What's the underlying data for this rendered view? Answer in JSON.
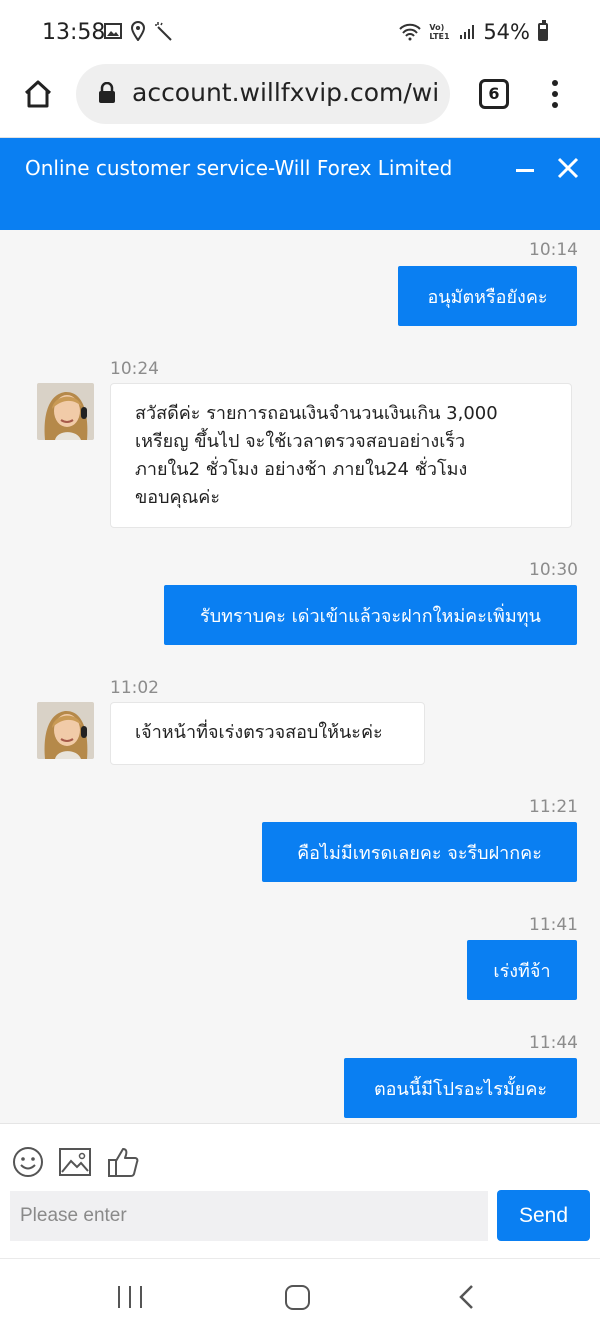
{
  "status_bar": {
    "time": "13:58",
    "battery": "54%",
    "network": "Vo) LTE1"
  },
  "browser": {
    "url": "account.willfxvip.com/wi",
    "tab_count": "6"
  },
  "chat": {
    "title": "Online customer service-Will Forex Limited",
    "messages": [
      {
        "direction": "out",
        "time": "10:14",
        "text": "อนุมัตหรือยังคะ"
      },
      {
        "direction": "in",
        "time": "10:24",
        "lines": [
          "สวัสดีค่ะ รายการถอนเงินจำนวนเงินเกิน 3,000",
          "เหรียญ ขึ้นไป จะใช้เวลาตรวจสอบอย่างเร็ว",
          "ภายใน2 ชั่วโมง อย่างช้า ภายใน24 ชั่วโมง",
          "ขอบคุณค่ะ"
        ]
      },
      {
        "direction": "out",
        "time": "10:30",
        "text": "รับทราบคะ เด่วเข้าแล้วจะฝากใหม่คะเพิ่มทุน"
      },
      {
        "direction": "in",
        "time": "11:02",
        "lines": [
          "เจ้าหน้าที่จเร่งตรวจสอบให้นะค่ะ"
        ]
      },
      {
        "direction": "out",
        "time": "11:21",
        "text": "คือไม่มีเทรดเลยคะ จะรีบฝากคะ"
      },
      {
        "direction": "out",
        "time": "11:41",
        "text": "เร่งทีจ้า"
      },
      {
        "direction": "out",
        "time": "11:44",
        "text": "ตอนนี้มีโปรอะไรมั้ยคะ"
      }
    ]
  },
  "composer": {
    "placeholder": "Please enter",
    "send_label": "Send"
  },
  "colors": {
    "accent": "#0a7ff2",
    "chat_bg": "#f6f6f6"
  }
}
